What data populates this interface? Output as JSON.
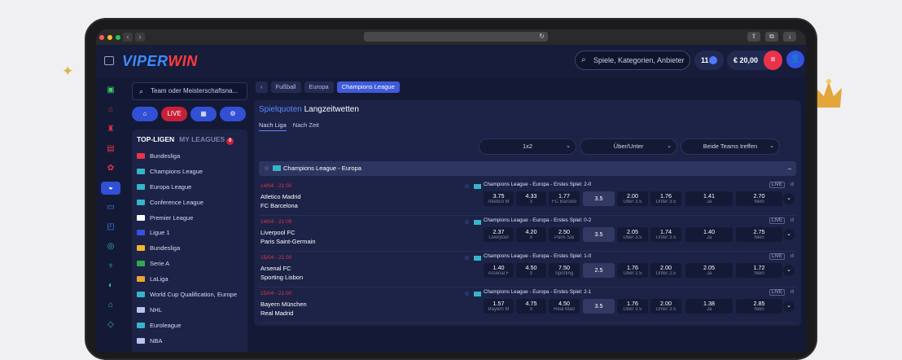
{
  "header": {
    "logo_part1": "VIPER",
    "logo_part2": "WIN",
    "search_placeholder": "Spiele, Kategorien, Anbieter",
    "notif_count": "11",
    "balance": "€ 20,00"
  },
  "sidebar": {
    "search_placeholder": "Team oder Meisterschaftsna...",
    "live_label": "LIVE",
    "tab_top": "TOP-LIGEN",
    "tab_my": "MY LEAGUES",
    "my_count": "0",
    "leagues": [
      {
        "label": "Bundesliga",
        "flag": "#e8334a"
      },
      {
        "label": "Champions League",
        "flag": "#35b5c9"
      },
      {
        "label": "Europa League",
        "flag": "#35b5c9"
      },
      {
        "label": "Conference League",
        "flag": "#35b5c9"
      },
      {
        "label": "Premier League",
        "flag": "#ffffff"
      },
      {
        "label": "Ligue 1",
        "flag": "#3552e0"
      },
      {
        "label": "Bundesliga",
        "flag": "#f2b632"
      },
      {
        "label": "Serie A",
        "flag": "#2fa84f"
      },
      {
        "label": "LaLiga",
        "flag": "#e8a732"
      },
      {
        "label": "World Cup Qualification, Europe",
        "flag": "#35b5c9"
      },
      {
        "label": "NHL",
        "flag": "#b9c3ef"
      },
      {
        "label": "Euroleague",
        "flag": "#35b5c9"
      },
      {
        "label": "NBA",
        "flag": "#b9c3ef"
      }
    ]
  },
  "breadcrumb": [
    "Fußball",
    "Europa",
    "Champions League"
  ],
  "main": {
    "title_part1": "Spielquoten",
    "title_part2": "Langzeitwetten",
    "subtab1": "Nach Liga",
    "subtab2": "Nach Zeit",
    "market1": "1x2",
    "market2": "Über/Unter",
    "market3": "Beide Teams treffen",
    "group": "Champions League - Europa",
    "live": "LIVE"
  },
  "events": [
    {
      "time": "14/04 - 21:00",
      "home": "Atletico Madrid",
      "away": "FC Barcelona",
      "info": "Champions League - Europa - Erstes Spiel: 2-0",
      "o1": "3.75",
      "l1": "Atletico M",
      "ox": "4.33",
      "lx": "X",
      "o2": "1.77",
      "l2": "FC Barcelo",
      "line": "3.5",
      "over": "2.00",
      "lo": "Über 3.5",
      "under": "1.76",
      "lu": "Unter 3.5",
      "yes": "1.41",
      "ly": "Ja",
      "no": "2.70",
      "ln": "Nein"
    },
    {
      "time": "14/04 - 21:00",
      "home": "Liverpool FC",
      "away": "Paris Saint-Germain",
      "info": "Champions League - Europa - Erstes Spiel: 0-2",
      "o1": "2.37",
      "l1": "Liverpool",
      "ox": "4.20",
      "lx": "X",
      "o2": "2.50",
      "l2": "Paris Sai",
      "line": "3.5",
      "over": "2.05",
      "lo": "Über 3.5",
      "under": "1.74",
      "lu": "Unter 3.5",
      "yes": "1.40",
      "ly": "Ja",
      "no": "2.75",
      "ln": "Nein"
    },
    {
      "time": "15/04 - 21:00",
      "home": "Arsenal FC",
      "away": "Sporting Lisbon",
      "info": "Champions League - Europa - Erstes Spiel: 1-0",
      "o1": "1.40",
      "l1": "Arsenal F",
      "ox": "4.50",
      "lx": "X",
      "o2": "7.50",
      "l2": "Sporting",
      "line": "2.5",
      "over": "1.76",
      "lo": "Über 2.5",
      "under": "2.00",
      "lu": "Unter 2.5",
      "yes": "2.05",
      "ly": "Ja",
      "no": "1.72",
      "ln": "Nein"
    },
    {
      "time": "15/04 - 21:00",
      "home": "Bayern München",
      "away": "Real Madrid",
      "info": "Champions League - Europa - Erstes Spiel: 2-1",
      "o1": "1.57",
      "l1": "Bayern M",
      "ox": "4.75",
      "lx": "X",
      "o2": "4.50",
      "l2": "Real Mad",
      "line": "3.5",
      "over": "1.76",
      "lo": "Über 3.5",
      "under": "2.00",
      "lu": "Unter 3.5",
      "yes": "1.38",
      "ly": "Ja",
      "no": "2.85",
      "ln": "Nein"
    }
  ]
}
